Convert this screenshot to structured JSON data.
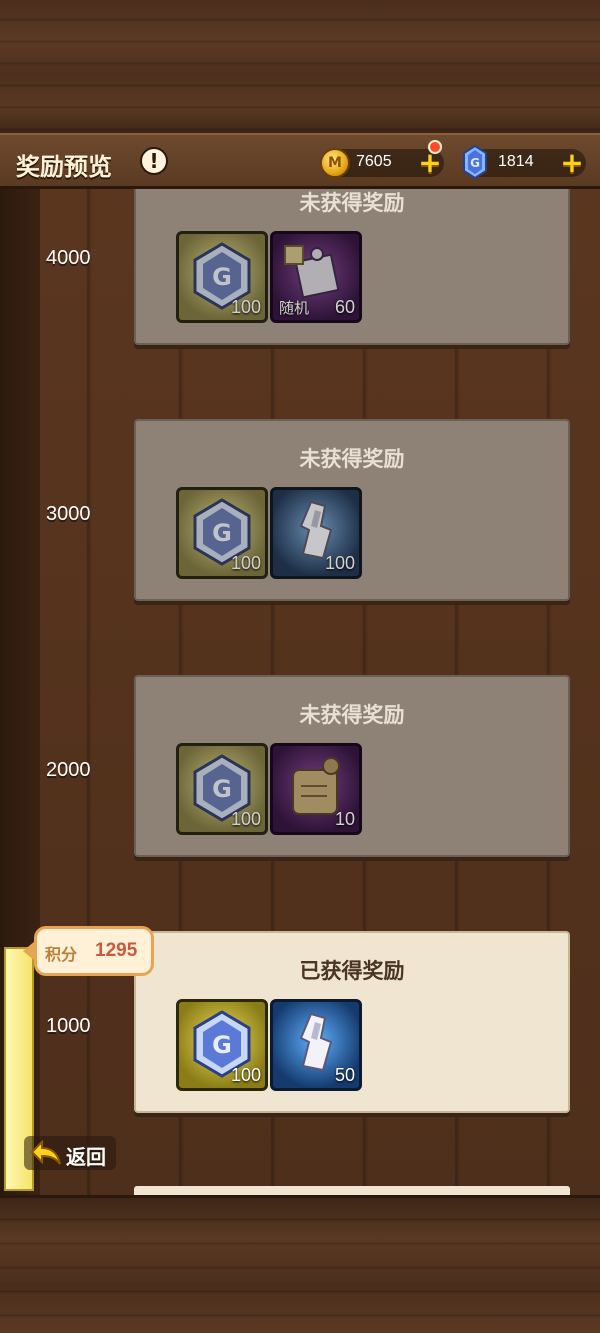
{
  "header": {
    "title": "奖励预览",
    "info_icon": "exclamation-icon",
    "gold": "7605",
    "gems": "1814"
  },
  "tiers": [
    {
      "threshold": "4000",
      "status": "未获得奖励",
      "claimed": false,
      "items": [
        {
          "icon": "g-gem-icon",
          "frame": "gold",
          "qty": "100"
        },
        {
          "icon": "puzzle-piece-icon",
          "frame": "purple",
          "qty": "60",
          "tag": "随机"
        }
      ]
    },
    {
      "threshold": "3000",
      "status": "未获得奖励",
      "claimed": false,
      "items": [
        {
          "icon": "g-gem-icon",
          "frame": "gold",
          "qty": "100"
        },
        {
          "icon": "crystal-shard-icon",
          "frame": "blue",
          "qty": "100"
        }
      ]
    },
    {
      "threshold": "2000",
      "status": "未获得奖励",
      "claimed": false,
      "items": [
        {
          "icon": "g-gem-icon",
          "frame": "gold",
          "qty": "100"
        },
        {
          "icon": "scroll-icon",
          "frame": "purple",
          "qty": "10"
        }
      ]
    },
    {
      "threshold": "1000",
      "status": "已获得奖励",
      "claimed": true,
      "items": [
        {
          "icon": "g-gem-icon",
          "frame": "gold",
          "qty": "100"
        },
        {
          "icon": "crystal-shard-icon",
          "frame": "blue",
          "qty": "50"
        }
      ]
    }
  ],
  "score": {
    "label": "积分",
    "value": "1295"
  },
  "back_label": "返回",
  "colors": {
    "gold_frame": "#efe05a",
    "blue_frame": "#5fb0ff",
    "purple_frame": "#b03cc8",
    "claimed_card": "#efe5d1",
    "locked_card": "#8d8275"
  }
}
